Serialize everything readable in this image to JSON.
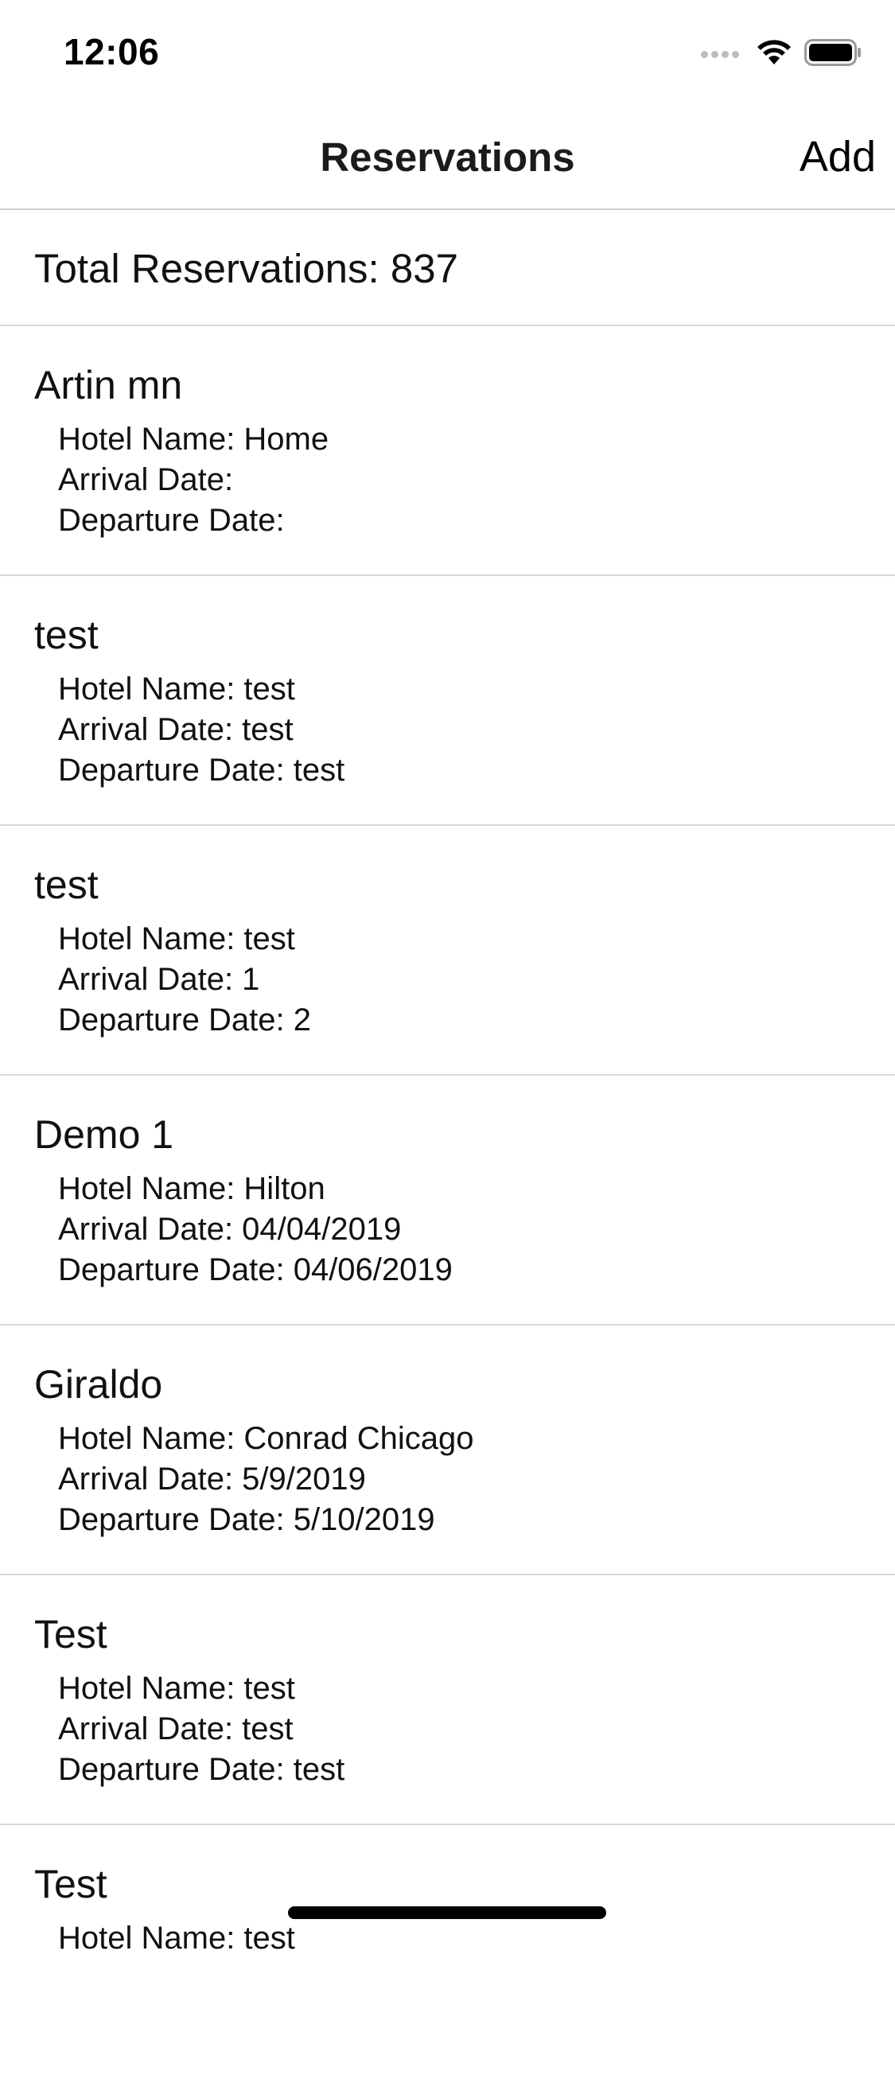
{
  "status_bar": {
    "time": "12:06",
    "icons": [
      "signal-icon",
      "wifi-icon",
      "battery-icon"
    ]
  },
  "nav": {
    "title": "Reservations",
    "add_label": "Add"
  },
  "summary": {
    "total_text": "Total Reservations: 837"
  },
  "reservations": [
    {
      "name": "Artin mn",
      "hotel": "Hotel Name: Home",
      "arrival": "Arrival Date: ",
      "departure": "Departure Date: "
    },
    {
      "name": "test",
      "hotel": "Hotel Name: test",
      "arrival": "Arrival Date: test",
      "departure": "Departure Date: test"
    },
    {
      "name": "test",
      "hotel": "Hotel Name: test",
      "arrival": "Arrival Date: 1",
      "departure": "Departure Date: 2"
    },
    {
      "name": "Demo 1",
      "hotel": "Hotel Name: Hilton",
      "arrival": "Arrival Date: 04/04/2019",
      "departure": "Departure Date: 04/06/2019"
    },
    {
      "name": "Giraldo",
      "hotel": "Hotel Name: Conrad Chicago",
      "arrival": "Arrival Date: 5/9/2019",
      "departure": "Departure Date: 5/10/2019"
    },
    {
      "name": "Test",
      "hotel": "Hotel Name: test",
      "arrival": "Arrival Date: test",
      "departure": "Departure Date: test"
    },
    {
      "name": "Test",
      "hotel": "Hotel Name: test",
      "arrival": "",
      "departure": ""
    }
  ],
  "colors": {
    "separator": "#d8d8dc",
    "text": "#111111",
    "background": "#ffffff"
  }
}
